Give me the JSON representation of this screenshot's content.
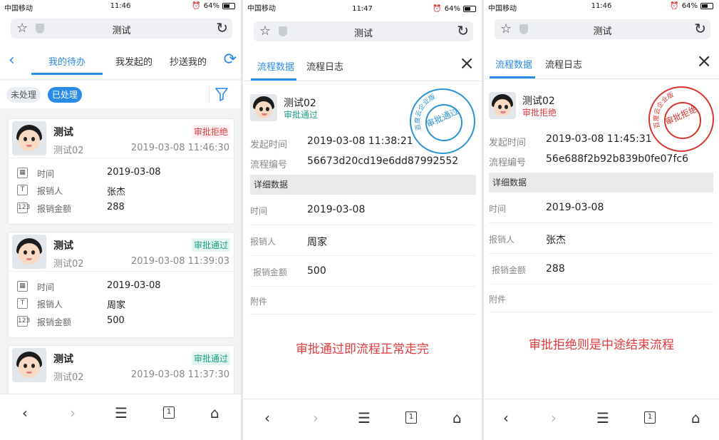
{
  "colors": {
    "accent": "#2a8be8",
    "reject": "#e4393c",
    "pass": "#1aa085",
    "stamp_blue": "#2a93d5",
    "stamp_red": "#d9342b"
  },
  "phone1": {
    "status": {
      "carrier": "中国移动",
      "time": "11:46",
      "battery": "64%",
      "battery_level": 0.64
    },
    "address": {
      "title": "测试"
    },
    "tabs": [
      "我的待办",
      "我发起的",
      "抄送我的"
    ],
    "filters": {
      "unprocessed": "未处理",
      "processed": "已处理"
    },
    "cards": [
      {
        "name": "测试",
        "sub": "测试02",
        "date": "2019-03-08 11:46:30",
        "status": "审批拒绝",
        "rows": [
          {
            "label": "时间",
            "value": "2019-03-08"
          },
          {
            "label": "报销人",
            "value": "张杰"
          },
          {
            "label": "报销金额",
            "value": "288"
          }
        ]
      },
      {
        "name": "测试",
        "sub": "测试02",
        "date": "2019-03-08 11:39:03",
        "status": "审批通过",
        "rows": [
          {
            "label": "时间",
            "value": "2019-03-08"
          },
          {
            "label": "报销人",
            "value": "周家"
          },
          {
            "label": "报销金额",
            "value": "500"
          }
        ]
      },
      {
        "name": "测试",
        "sub": "测试02",
        "date": "2019-03-08 11:37:30",
        "status": "审批通过"
      }
    ],
    "row_icons": [
      "calendar-icon",
      "text-icon",
      "number-icon"
    ]
  },
  "phone2": {
    "status": {
      "carrier": "中国移动",
      "time": "11:47",
      "battery": "64%",
      "battery_level": 0.64
    },
    "address": {
      "title": "测试"
    },
    "tabs": [
      "流程数据",
      "流程日志"
    ],
    "name": "测试02",
    "status_text": "审批通过",
    "start_label": "发起时间",
    "start_value": "2019-03-08 11:38:21",
    "id_label": "流程编号",
    "id_value": "56673d20cd19e6dd87992552",
    "section": "详细数据",
    "details": [
      {
        "label": "时间",
        "value": "2019-03-08"
      },
      {
        "label": "报销人",
        "value": "周家"
      },
      {
        "label": "报销金额",
        "value": "500"
      },
      {
        "label": "附件",
        "value": ""
      }
    ],
    "stamp": {
      "ring": "百度云企业版",
      "center": "审批通过"
    },
    "note": "审批通过即流程正常走完"
  },
  "phone3": {
    "status": {
      "carrier": "中国移动",
      "time": "11:46",
      "battery": "64%",
      "battery_level": 0.64
    },
    "address": {
      "title": "测试"
    },
    "tabs": [
      "流程数据",
      "流程日志"
    ],
    "name": "测试02",
    "status_text": "审批拒绝",
    "start_label": "发起时间",
    "start_value": "2019-03-08 11:45:31",
    "id_label": "流程编号",
    "id_value": "56e688f2b92b839b0fe07fc6",
    "section": "详细数据",
    "details": [
      {
        "label": "时间",
        "value": "2019-03-08"
      },
      {
        "label": "报销人",
        "value": "张杰"
      },
      {
        "label": "报销金额",
        "value": "288"
      },
      {
        "label": "附件",
        "value": ""
      }
    ],
    "stamp": {
      "ring": "百度云企业版",
      "center": "审批拒绝"
    },
    "note": "审批拒绝则是中途结束流程"
  },
  "bottomnav": {
    "tabs_count": "1",
    "icons": [
      "back-icon",
      "forward-icon",
      "menu-icon",
      "tabs-icon",
      "home-icon"
    ]
  }
}
